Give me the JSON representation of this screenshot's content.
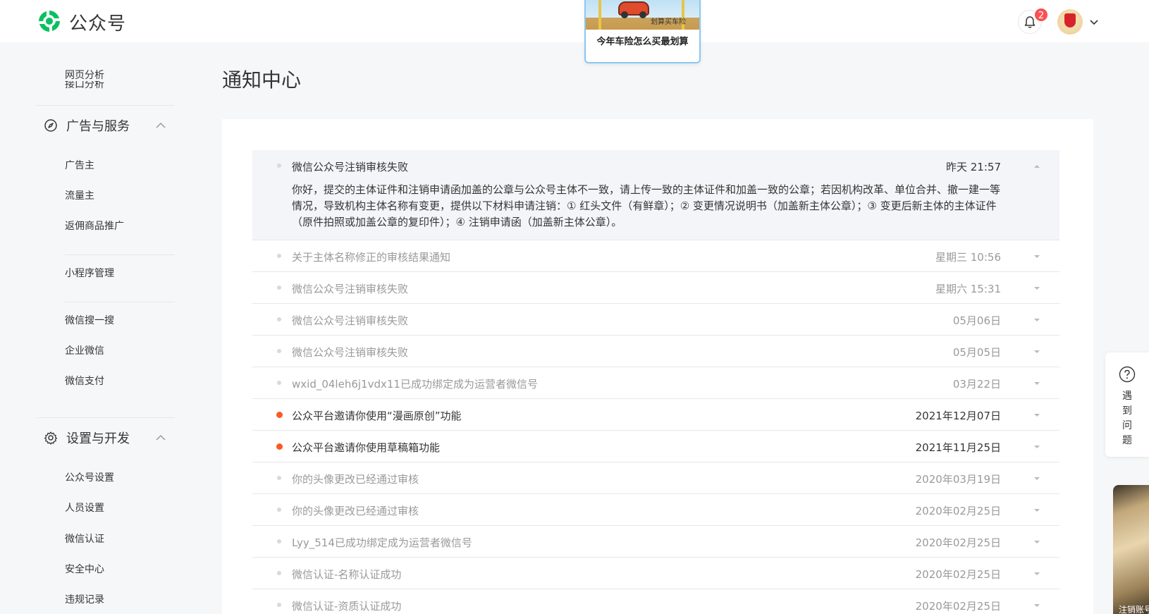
{
  "header": {
    "brand": "公众号",
    "notification_count": "2"
  },
  "ad_popup": {
    "image_caption": "划算买车险",
    "title": "今年车险怎么买最划算"
  },
  "sidebar": {
    "cut_item": "接口分析",
    "top_items": [
      "网页分析"
    ],
    "sections": [
      {
        "label": "广告与服务",
        "icon": "compass-icon",
        "items": [
          "广告主",
          "流量主",
          "返佣商品推广"
        ]
      },
      {
        "items": [
          "小程序管理"
        ]
      },
      {
        "items": [
          "微信搜一搜",
          "企业微信",
          "微信支付"
        ]
      },
      {
        "label": "设置与开发",
        "icon": "gear-icon",
        "items": [
          "公众号设置",
          "人员设置",
          "微信认证",
          "安全中心",
          "违规记录"
        ]
      }
    ]
  },
  "main": {
    "page_title": "通知中心",
    "notifications": [
      {
        "title": "微信公众号注销审核失败",
        "time": "昨天 21:57",
        "unread": false,
        "expanded": true,
        "body": "你好，提交的主体证件和注销申请函加盖的公章与公众号主体不一致，请上传一致的主体证件和加盖一致的公章；若因机构改革、单位合并、撤一建一等情况，导致机构主体名称有变更，提供以下材料申请注销：① 红头文件（有鲜章）；② 变更情况说明书（加盖新主体公章）；③ 变更后新主体的主体证件（原件拍照或加盖公章的复印件）；④ 注销申请函（加盖新主体公章）。"
      },
      {
        "title": "关于主体名称修正的审核结果通知",
        "time": "星期三 10:56",
        "unread": false
      },
      {
        "title": "微信公众号注销审核失败",
        "time": "星期六 15:31",
        "unread": false
      },
      {
        "title": "微信公众号注销审核失败",
        "time": "05月06日",
        "unread": false
      },
      {
        "title": "微信公众号注销审核失败",
        "time": "05月05日",
        "unread": false
      },
      {
        "title": "wxid_04leh6j1vdx11已成功绑定成为运营者微信号",
        "time": "03月22日",
        "unread": false
      },
      {
        "title": "公众平台邀请你使用“漫画原创”功能",
        "time": "2021年12月07日",
        "unread": true
      },
      {
        "title": "公众平台邀请你使用草稿箱功能",
        "time": "2021年11月25日",
        "unread": true
      },
      {
        "title": "你的头像更改已经通过审核",
        "time": "2020年03月19日",
        "unread": false
      },
      {
        "title": "你的头像更改已经通过审核",
        "time": "2020年02月25日",
        "unread": false
      },
      {
        "title": "Lyy_514已成功绑定成为运营者微信号",
        "time": "2020年02月25日",
        "unread": false
      },
      {
        "title": "微信认证-名称认证成功",
        "time": "2020年02月25日",
        "unread": false
      },
      {
        "title": "微信认证-资质认证成功",
        "time": "2020年02月25日",
        "unread": false
      }
    ]
  },
  "help": {
    "label": "遇到问题"
  },
  "video": {
    "caption": "注销账号"
  },
  "colors": {
    "brand_green": "#07c160",
    "unread_dot": "#fa5a23",
    "badge_red": "#fa5151",
    "ad_border": "#8cc7f2"
  }
}
